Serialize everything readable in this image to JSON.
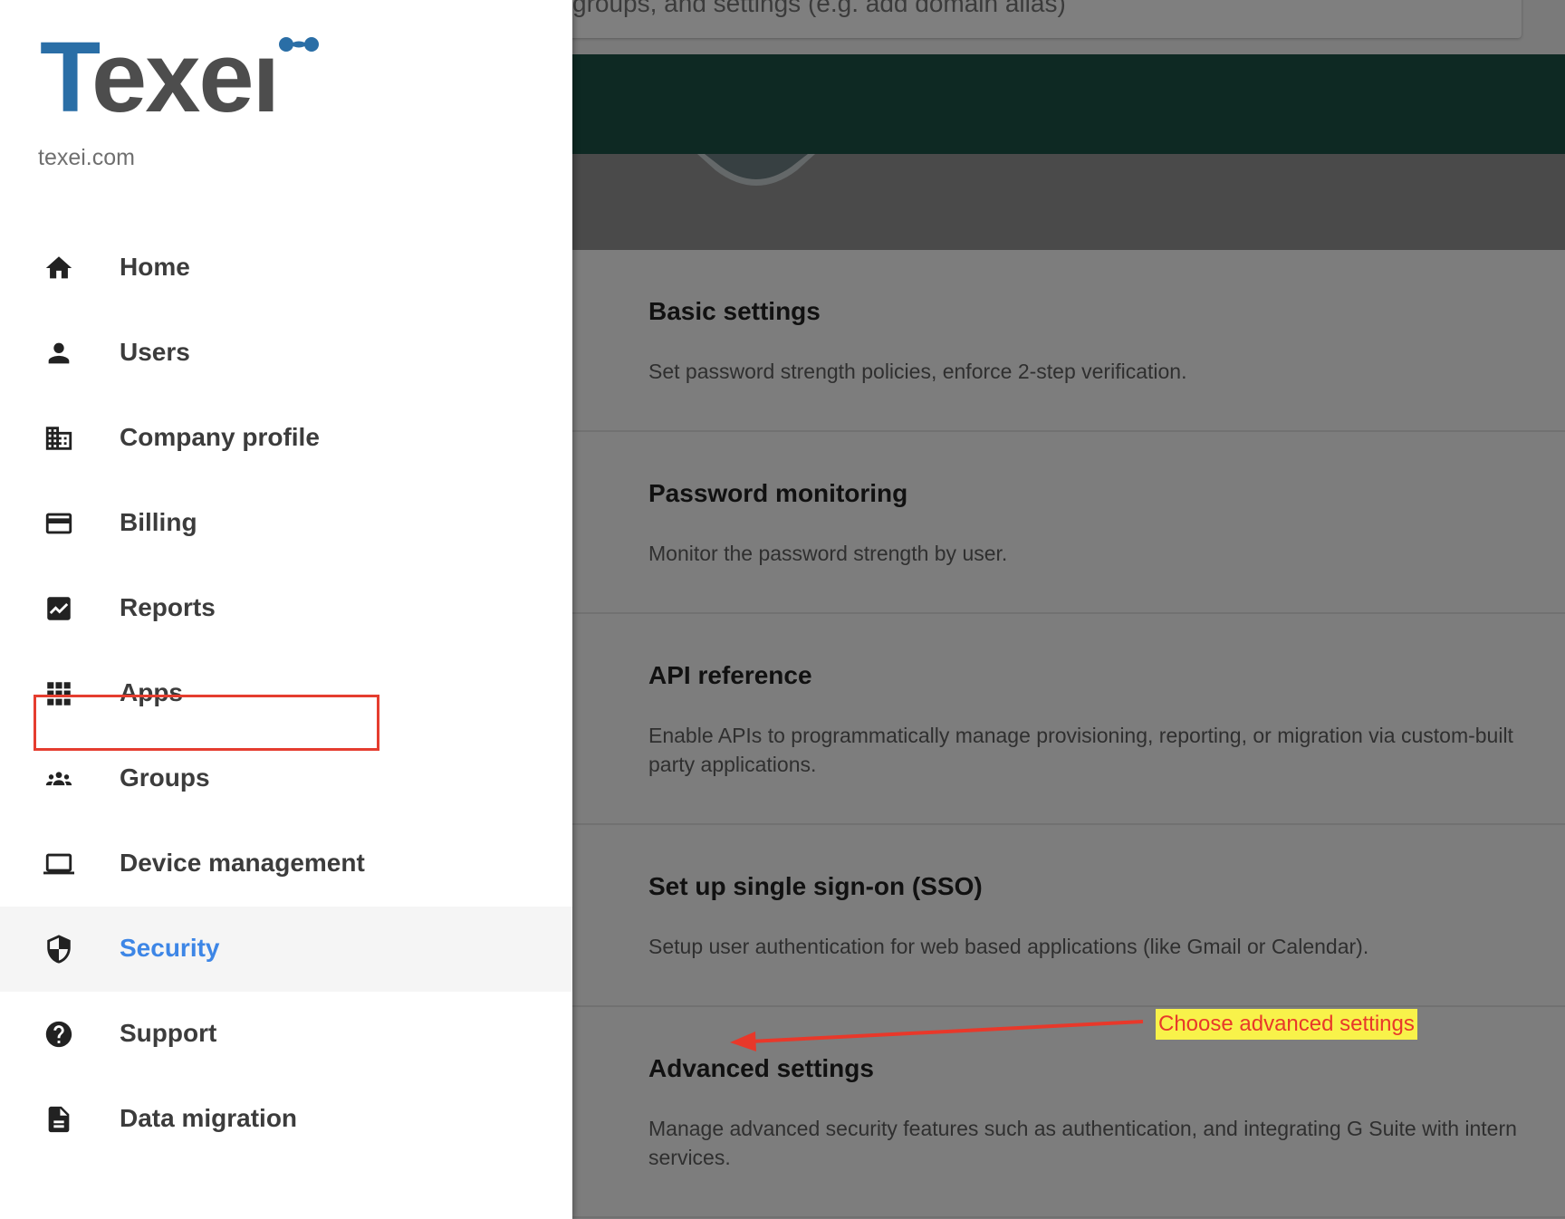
{
  "search": {
    "placeholder_text": "groups, and settings (e.g. add domain alias)"
  },
  "cards": [
    {
      "title": "Basic settings",
      "description": [
        "Set password strength policies, enforce 2-step verification."
      ]
    },
    {
      "title": "Password monitoring",
      "description": [
        "Monitor the password strength by user."
      ]
    },
    {
      "title": "API reference",
      "description": [
        "Enable APIs to programmatically manage provisioning, reporting, or migration via custom-built",
        "party applications."
      ]
    },
    {
      "title": "Set up single sign-on (SSO)",
      "description": [
        "Setup user authentication for web based applications (like Gmail or Calendar)."
      ]
    },
    {
      "title": "Advanced settings",
      "description": [
        "Manage advanced security features such as authentication, and integrating G Suite with intern",
        "services."
      ]
    }
  ],
  "annotation": {
    "label": "Choose advanced settings",
    "arrow_color": "#e8382a",
    "label_bg": "#f8f24a"
  },
  "drawer": {
    "logo": "Texei",
    "domain": "texei.com",
    "active_item": "Security",
    "accent_color": "#3d86e6",
    "items": [
      {
        "label": "Home",
        "icon": "home-icon"
      },
      {
        "label": "Users",
        "icon": "person-icon"
      },
      {
        "label": "Company profile",
        "icon": "building-icon"
      },
      {
        "label": "Billing",
        "icon": "credit-card-icon"
      },
      {
        "label": "Reports",
        "icon": "chart-icon"
      },
      {
        "label": "Apps",
        "icon": "apps-grid-icon"
      },
      {
        "label": "Groups",
        "icon": "groups-icon"
      },
      {
        "label": "Device management",
        "icon": "laptop-icon"
      },
      {
        "label": "Security",
        "icon": "shield-icon"
      },
      {
        "label": "Support",
        "icon": "help-icon"
      },
      {
        "label": "Data migration",
        "icon": "data-migration-icon"
      }
    ]
  }
}
